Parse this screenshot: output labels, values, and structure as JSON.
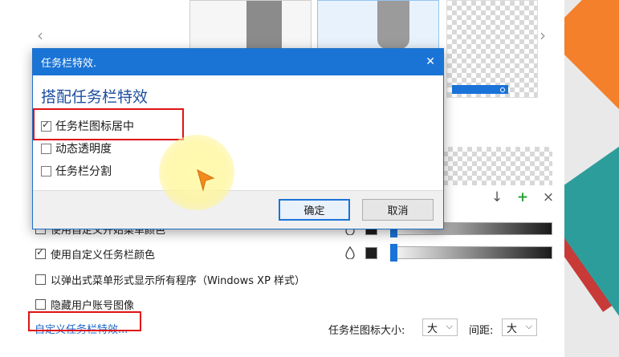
{
  "colors": {
    "accent": "#1a74d6",
    "highlight_box": "#e01313",
    "link": "#1a66c9"
  },
  "dialog": {
    "title": "任务栏特效.",
    "close_icon": "close-icon",
    "heading": "搭配任务栏特效",
    "options": [
      {
        "label": "任务栏图标居中",
        "checked": true
      },
      {
        "label": "动态透明度",
        "checked": false
      },
      {
        "label": "任务栏分割",
        "checked": false
      }
    ],
    "ok_label": "确定",
    "cancel_label": "取消"
  },
  "settings": {
    "options": [
      {
        "label": "使用自定义开始菜单颜色",
        "checked": true
      },
      {
        "label": "使用自定义任务栏颜色",
        "checked": true
      },
      {
        "label": "以弹出式菜单形式显示所有程序（Windows XP 样式）",
        "checked": false
      },
      {
        "label": "隐藏用户账号图像",
        "checked": false
      }
    ],
    "custom_effects_link": "自定义任务栏特效...",
    "icon_size_label": "任务栏图标大小:",
    "icon_size_value": "大",
    "spacing_label": "间距:",
    "spacing_value": "大"
  }
}
